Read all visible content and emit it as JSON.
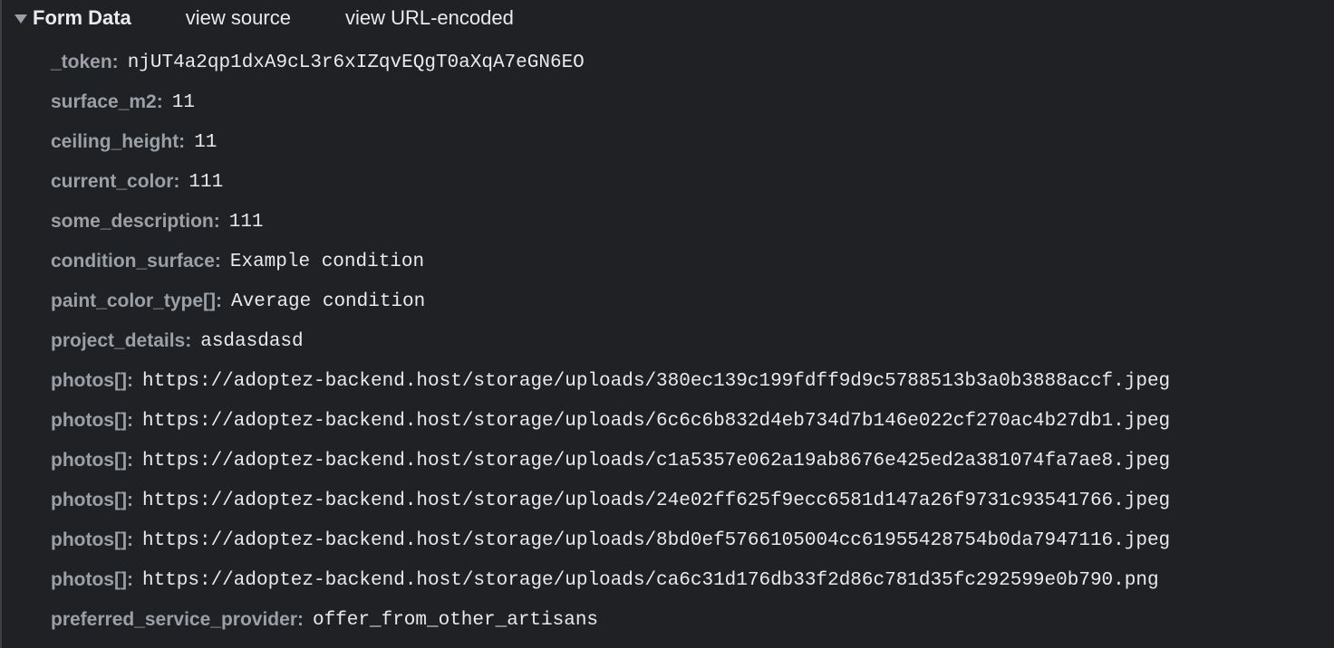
{
  "header": {
    "title": "Form Data",
    "view_source": "view source",
    "view_url_encoded": "view URL-encoded"
  },
  "rows": [
    {
      "key": "_token:",
      "value": "njUT4a2qp1dxA9cL3r6xIZqvEQgT0aXqA7eGN6EO"
    },
    {
      "key": "surface_m2:",
      "value": "11"
    },
    {
      "key": "ceiling_height:",
      "value": "11"
    },
    {
      "key": "current_color:",
      "value": "111"
    },
    {
      "key": "some_description:",
      "value": "111"
    },
    {
      "key": "condition_surface:",
      "value": "Example condition"
    },
    {
      "key": "paint_color_type[]:",
      "value": "Average condition"
    },
    {
      "key": "project_details:",
      "value": "asdasdasd"
    },
    {
      "key": "photos[]:",
      "value": "https://adoptez-backend.host/storage/uploads/380ec139c199fdff9d9c5788513b3a0b3888accf.jpeg"
    },
    {
      "key": "photos[]:",
      "value": "https://adoptez-backend.host/storage/uploads/6c6c6b832d4eb734d7b146e022cf270ac4b27db1.jpeg"
    },
    {
      "key": "photos[]:",
      "value": "https://adoptez-backend.host/storage/uploads/c1a5357e062a19ab8676e425ed2a381074fa7ae8.jpeg"
    },
    {
      "key": "photos[]:",
      "value": "https://adoptez-backend.host/storage/uploads/24e02ff625f9ecc6581d147a26f9731c93541766.jpeg"
    },
    {
      "key": "photos[]:",
      "value": "https://adoptez-backend.host/storage/uploads/8bd0ef5766105004cc61955428754b0da7947116.jpeg"
    },
    {
      "key": "photos[]:",
      "value": "https://adoptez-backend.host/storage/uploads/ca6c31d176db33f2d86c781d35fc292599e0b790.png"
    },
    {
      "key": "preferred_service_provider:",
      "value": "offer_from_other_artisans"
    }
  ]
}
